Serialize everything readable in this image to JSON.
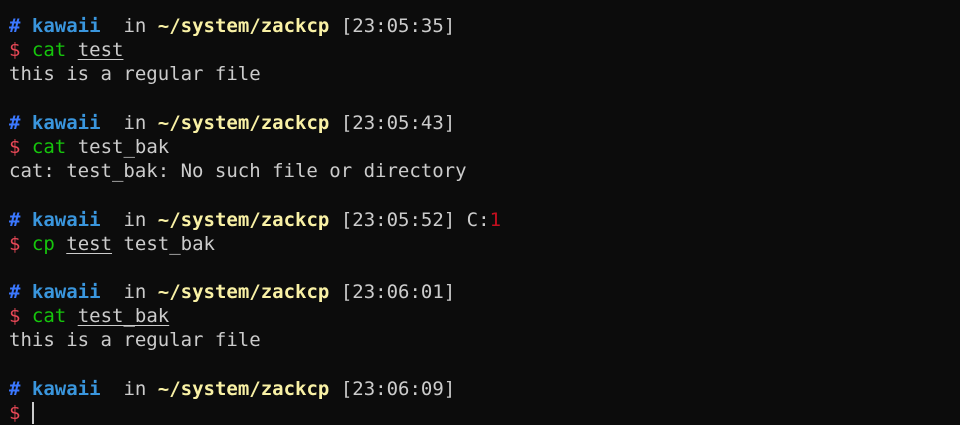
{
  "colors": {
    "background": "#0c0c0c",
    "hash": "#3b78ff",
    "user": "#3a96dd",
    "path": "#f9f1a5",
    "dollar": "#e74856",
    "command": "#16c60c",
    "exit_code": "#c50f1f"
  },
  "prompt": {
    "hash": "#",
    "user": "kawaii",
    "in": "in",
    "path": "~/system/zackcp",
    "dollar": "$"
  },
  "blocks": [
    {
      "time": "[23:05:35]",
      "command": "cat",
      "arg1": "test",
      "output": "this is a regular file"
    },
    {
      "time": "[23:05:43]",
      "command": "cat",
      "arg1": "test_bak",
      "output": "cat: test_bak: No such file or directory"
    },
    {
      "time": "[23:05:52]",
      "exit_label": "C:",
      "exit_code": "1",
      "command": "cp",
      "arg1": "test",
      "arg2": "test_bak"
    },
    {
      "time": "[23:06:01]",
      "command": "cat",
      "arg1": "test_bak",
      "output": "this is a regular file"
    },
    {
      "time": "[23:06:09]"
    }
  ]
}
